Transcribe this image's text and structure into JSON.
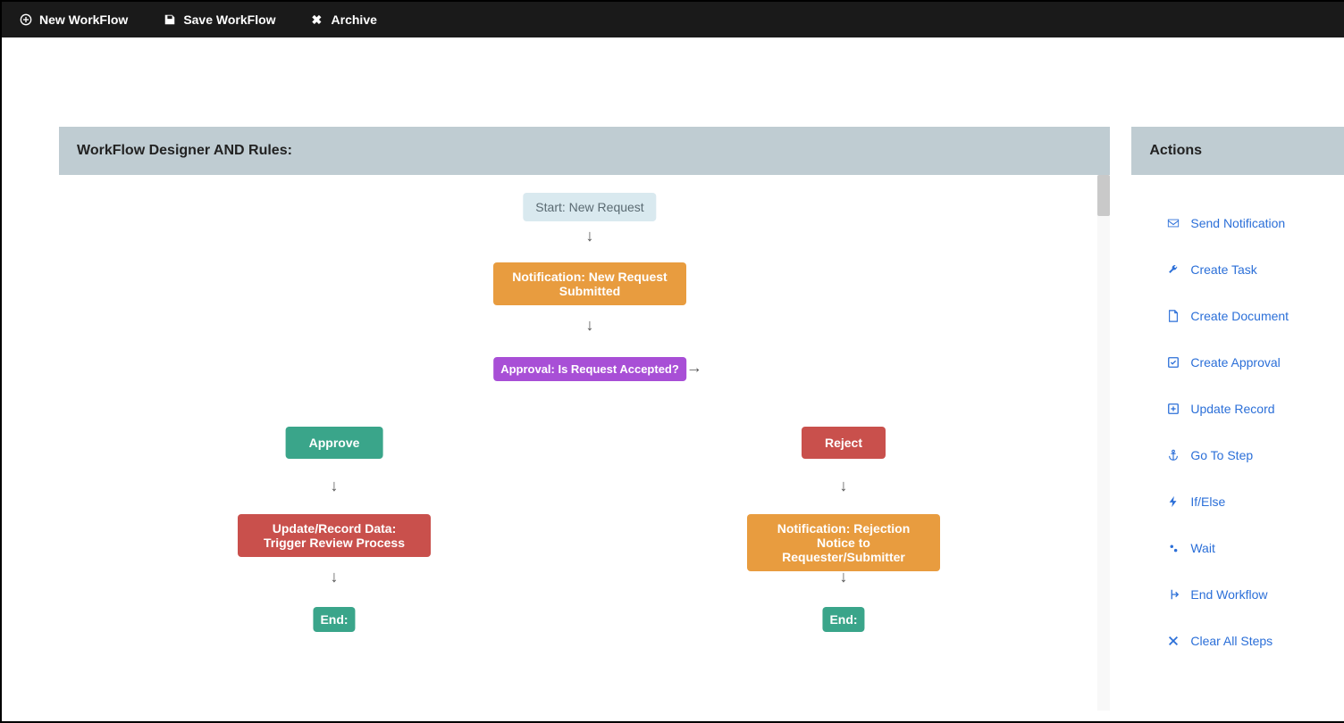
{
  "topbar": {
    "new_label": "New WorkFlow",
    "save_label": "Save WorkFlow",
    "archive_label": "Archive"
  },
  "designer": {
    "header": "WorkFlow Designer AND Rules:"
  },
  "flow": {
    "start": "Start: New Request",
    "notification_new": "Notification: New Request Submitted",
    "approval": "Approval: Is Request Accepted?",
    "approve": "Approve",
    "reject": "Reject",
    "update_record": "Update/Record Data: Trigger Review Process",
    "rejection_notice": "Notification: Rejection Notice to Requester/Submitter",
    "end_left": "End:",
    "end_right": "End:"
  },
  "actions": {
    "header": "Actions",
    "items": [
      {
        "label": "Send Notification",
        "icon": "envelope-icon"
      },
      {
        "label": "Create Task",
        "icon": "wrench-icon"
      },
      {
        "label": "Create Document",
        "icon": "document-icon"
      },
      {
        "label": "Create Approval",
        "icon": "check-square-icon"
      },
      {
        "label": "Update Record",
        "icon": "plus-square-icon"
      },
      {
        "label": "Go To Step",
        "icon": "anchor-icon"
      },
      {
        "label": "If/Else",
        "icon": "bolt-icon"
      },
      {
        "label": "Wait",
        "icon": "gears-icon"
      },
      {
        "label": "End Workflow",
        "icon": "exit-icon"
      },
      {
        "label": "Clear All Steps",
        "icon": "x-icon"
      }
    ]
  }
}
